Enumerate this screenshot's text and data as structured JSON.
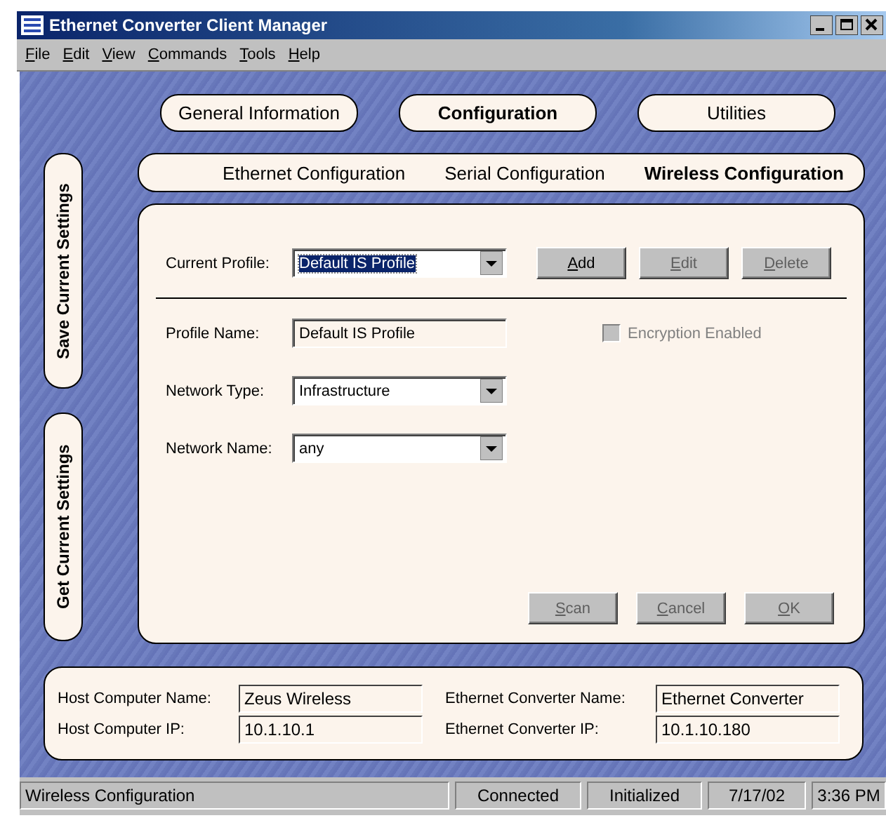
{
  "window": {
    "title": "Ethernet Converter Client Manager"
  },
  "menu": [
    {
      "label": "File"
    },
    {
      "label": "Edit"
    },
    {
      "label": "View"
    },
    {
      "label": "Commands"
    },
    {
      "label": "Tools"
    },
    {
      "label": "Help"
    }
  ],
  "tabs": [
    {
      "label": "General Information",
      "selected": false
    },
    {
      "label": "Configuration",
      "selected": true
    },
    {
      "label": "Utilities",
      "selected": false
    }
  ],
  "subtabs": [
    {
      "label": "Ethernet Configuration",
      "selected": false
    },
    {
      "label": "Serial Configuration",
      "selected": false
    },
    {
      "label": "Wireless Configuration",
      "selected": true
    }
  ],
  "side_buttons": [
    {
      "label": "Save Current Settings"
    },
    {
      "label": "Get Current Settings"
    }
  ],
  "profile": {
    "label": "Current Profile:",
    "value": "Default IS Profile",
    "buttons": [
      {
        "label": "Add",
        "disabled": false
      },
      {
        "label": "Edit",
        "disabled": true
      },
      {
        "label": "Delete",
        "disabled": true
      }
    ]
  },
  "fields": [
    {
      "kind": "text",
      "label": "Profile Name:",
      "value": "Default IS Profile"
    },
    {
      "kind": "dropdown",
      "label": "Network Type:",
      "value": "Infrastructure"
    },
    {
      "kind": "dropdown",
      "label": "Network Name:",
      "value": "any"
    }
  ],
  "encryption": {
    "label": "Encryption Enabled",
    "checked": false,
    "disabled": true
  },
  "action_buttons": [
    {
      "label": "Scan",
      "disabled": true
    },
    {
      "label": "Cancel",
      "disabled": true
    },
    {
      "label": "OK",
      "disabled": true
    }
  ],
  "host": [
    {
      "label": "Host Computer Name:",
      "value": "Zeus Wireless"
    },
    {
      "label": "Host Computer IP:",
      "value": "10.1.10.1"
    }
  ],
  "converter": [
    {
      "label": "Ethernet Converter Name:",
      "value": "Ethernet Converter"
    },
    {
      "label": "Ethernet Converter IP:",
      "value": "10.1.10.180"
    }
  ],
  "status_bar": [
    "Wireless Configuration",
    "Connected",
    "Initialized",
    "7/17/02",
    "3:36 PM"
  ]
}
